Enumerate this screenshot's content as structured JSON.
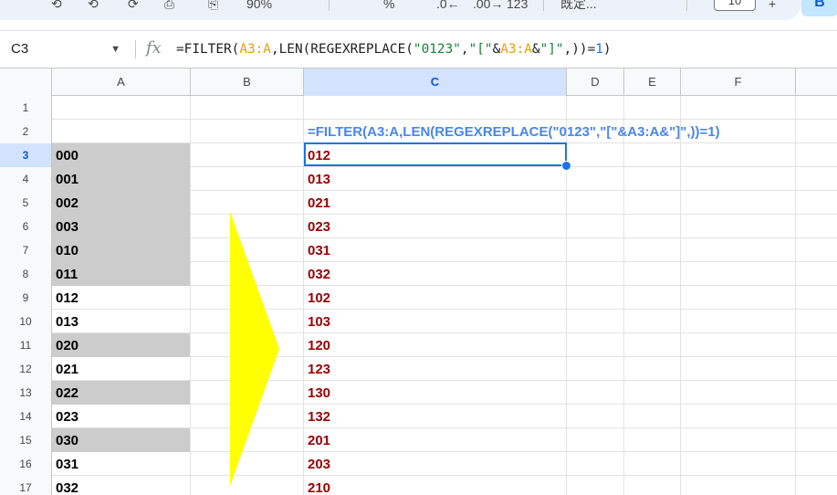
{
  "toolbar": {
    "font_size": "10",
    "chip_label": "B",
    "fragments": [
      "⟲",
      "⟳",
      "⎙",
      "⎘",
      "90%",
      "▾",
      "%",
      ".0←",
      ".00→",
      "123",
      "既定..."
    ]
  },
  "formula_bar": {
    "name_box": "C3",
    "fx_label": "fx",
    "formula_parts": [
      {
        "t": "=FILTER(",
        "k": "plain"
      },
      {
        "t": "A3:A",
        "k": "ref"
      },
      {
        "t": ",LEN(REGEXREPLACE(",
        "k": "plain"
      },
      {
        "t": "\"0123\"",
        "k": "str"
      },
      {
        "t": ",",
        "k": "plain"
      },
      {
        "t": "\"[\"",
        "k": "str"
      },
      {
        "t": "&",
        "k": "plain"
      },
      {
        "t": "A3:A",
        "k": "ref"
      },
      {
        "t": "&",
        "k": "plain"
      },
      {
        "t": "\"]\"",
        "k": "str"
      },
      {
        "t": ",))=",
        "k": "plain"
      },
      {
        "t": "1",
        "k": "num"
      },
      {
        "t": ")",
        "k": "plain"
      }
    ]
  },
  "grid": {
    "columns": [
      "A",
      "B",
      "C",
      "D",
      "E",
      "F"
    ],
    "active_column": "C",
    "active_row": "3",
    "formula_display": "=FILTER(A3:A,LEN(REGEXREPLACE(\"0123\",\"[\"&A3:A&\"]\",))=1)",
    "rows": [
      {
        "n": "1",
        "a": "",
        "shaded": false,
        "c": ""
      },
      {
        "n": "2",
        "a": "",
        "shaded": false,
        "c": ""
      },
      {
        "n": "3",
        "a": "000",
        "shaded": true,
        "c": "012"
      },
      {
        "n": "4",
        "a": "001",
        "shaded": true,
        "c": "013"
      },
      {
        "n": "5",
        "a": "002",
        "shaded": true,
        "c": "021"
      },
      {
        "n": "6",
        "a": "003",
        "shaded": true,
        "c": "023"
      },
      {
        "n": "7",
        "a": "010",
        "shaded": true,
        "c": "031"
      },
      {
        "n": "8",
        "a": "011",
        "shaded": true,
        "c": "032"
      },
      {
        "n": "9",
        "a": "012",
        "shaded": false,
        "c": "102"
      },
      {
        "n": "10",
        "a": "013",
        "shaded": false,
        "c": "103"
      },
      {
        "n": "11",
        "a": "020",
        "shaded": true,
        "c": "120"
      },
      {
        "n": "12",
        "a": "021",
        "shaded": false,
        "c": "123"
      },
      {
        "n": "13",
        "a": "022",
        "shaded": true,
        "c": "130"
      },
      {
        "n": "14",
        "a": "023",
        "shaded": false,
        "c": "132"
      },
      {
        "n": "15",
        "a": "030",
        "shaded": true,
        "c": "201"
      },
      {
        "n": "16",
        "a": "031",
        "shaded": false,
        "c": "203"
      },
      {
        "n": "17",
        "a": "032",
        "shaded": false,
        "c": "210"
      }
    ]
  },
  "colors": {
    "arrow": "#ffff00",
    "selection": "#1a73e8",
    "result_text": "#990000",
    "formula_text": "#4a86e8",
    "shaded_cell": "#cccccc"
  }
}
